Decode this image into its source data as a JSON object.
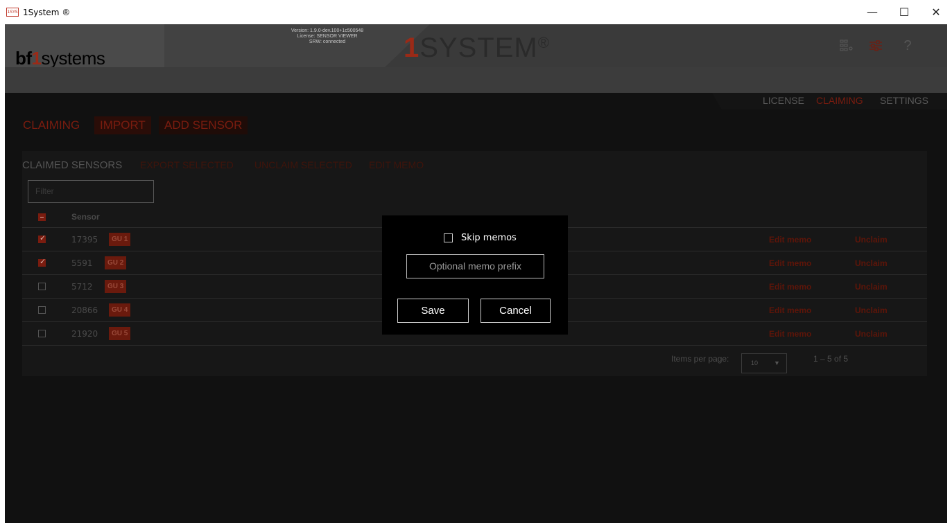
{
  "window": {
    "icon_text": "1SYS",
    "title": "1System ®",
    "minimize": "—",
    "maximize": "☐",
    "close": "✕"
  },
  "header": {
    "logo_prefix": "bf",
    "logo_one": "1",
    "logo_suffix": "systems",
    "version_lines": [
      "Version: 1.9.0-dev.100+1c500548",
      "License: SENSOR VIEWER",
      "SRW: connected"
    ],
    "brand_one": "1",
    "brand_text": "SYSTEM",
    "brand_reg": "®",
    "icons": [
      "grid-icon",
      "sliders-icon",
      "help-icon"
    ]
  },
  "topnav": {
    "items": [
      {
        "label": "LICENSE",
        "color": "#5a5a5a"
      },
      {
        "label": "CLAIMING",
        "color": "#7a1c0f"
      },
      {
        "label": "SETTINGS",
        "color": "#5a5a5a"
      }
    ]
  },
  "subtabs": [
    "CLAIMING",
    "IMPORT",
    "ADD SENSOR"
  ],
  "card": {
    "toolbar": {
      "title": "CLAIMED SENSORS",
      "export": "EXPORT SELECTED",
      "unclaim": "UNCLAIM SELECTED",
      "edit_memo": "EDIT MEMO"
    },
    "filter_placeholder": "Filter",
    "column_sensor": "Sensor",
    "rows": [
      {
        "id": "17395",
        "gu": "GU 1",
        "checked": true,
        "edit": "Edit memo",
        "unclaim": "Unclaim"
      },
      {
        "id": "5591",
        "gu": "GU 2",
        "checked": true,
        "edit": "Edit memo",
        "unclaim": "Unclaim"
      },
      {
        "id": "5712",
        "gu": "GU 3",
        "checked": false,
        "edit": "Edit memo",
        "unclaim": "Unclaim"
      },
      {
        "id": "20866",
        "gu": "GU 4",
        "checked": false,
        "edit": "Edit memo",
        "unclaim": "Unclaim"
      },
      {
        "id": "21920",
        "gu": "GU 5",
        "checked": false,
        "edit": "Edit memo",
        "unclaim": "Unclaim"
      }
    ],
    "paginator": {
      "label": "Items per page:",
      "value": "10",
      "range": "1 – 5 of 5"
    }
  },
  "dialog": {
    "skip_label": "Skip memos",
    "skip_checked": false,
    "memo_placeholder": "Optional memo prefix",
    "save": "Save",
    "cancel": "Cancel"
  },
  "colors": {
    "accent": "#7a1c0f",
    "background": "#111111",
    "dialog": "#000000"
  }
}
